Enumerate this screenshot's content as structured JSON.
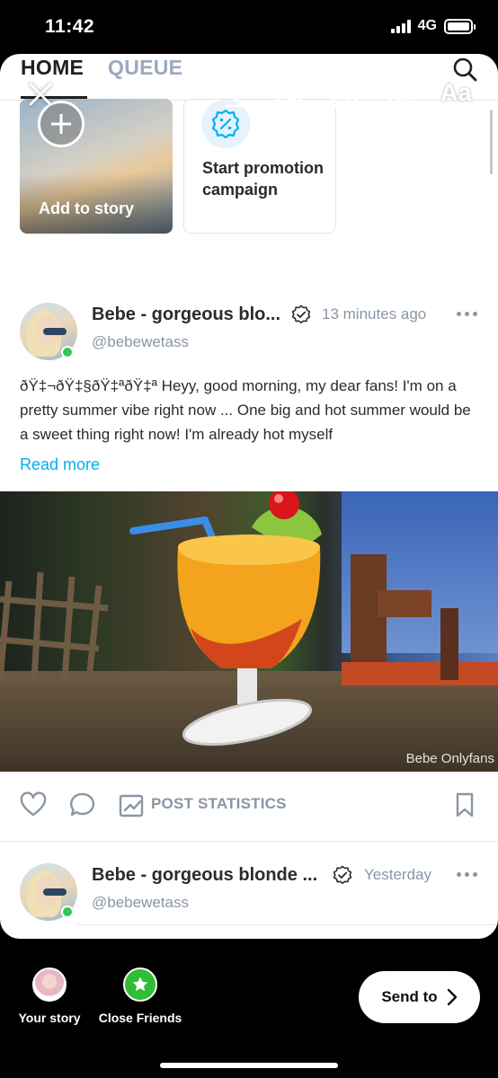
{
  "status_bar": {
    "time": "11:42",
    "network": "4G"
  },
  "tabs": {
    "home": "HOME",
    "queue": "QUEUE"
  },
  "overlay": {
    "text_tool": "Aa"
  },
  "stories": {
    "add_label": "Add to story",
    "promo_label": "Start promotion campaign"
  },
  "post1": {
    "name": "Bebe - gorgeous blo...",
    "handle": "@bebewetass",
    "time": "13 minutes ago",
    "text": "ðŸ‡¬ðŸ‡§ðŸ‡ªðŸ‡ª Heyy, good morning, my dear fans! I'm on a pretty summer vibe right now ... One big and hot summer would be a sweet thing right now! I'm already hot myself",
    "read_more": "Read more",
    "watermark": "Bebe Onlyfans",
    "stats_label": "POST STATISTICS"
  },
  "post2": {
    "name": "Bebe - gorgeous blonde ...",
    "handle": "@bebewetass",
    "time": "Yesterday"
  },
  "share": {
    "your_story": "Your story",
    "close_friends": "Close Friends",
    "send_to": "Send to"
  },
  "colors": {
    "accent": "#00aff0",
    "online": "#34c759",
    "muted": "#8a96a3",
    "close_friends": "#2fbd36"
  }
}
